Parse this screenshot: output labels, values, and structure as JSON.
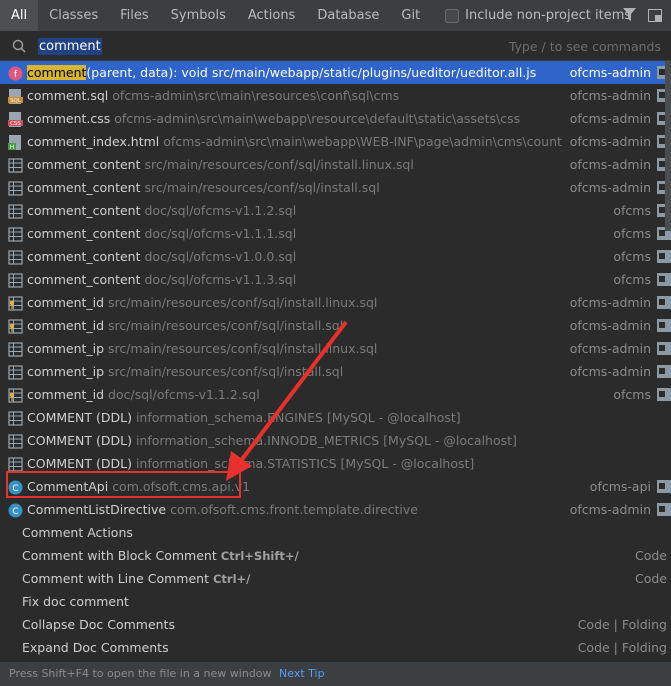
{
  "tabs": [
    {
      "label": "All",
      "active": true
    },
    {
      "label": "Classes",
      "active": false
    },
    {
      "label": "Files",
      "active": false
    },
    {
      "label": "Symbols",
      "active": false
    },
    {
      "label": "Actions",
      "active": false
    },
    {
      "label": "Database",
      "active": false
    },
    {
      "label": "Git",
      "active": false
    }
  ],
  "include_non_project": {
    "label": "Include non-project items",
    "checked": false
  },
  "toolbar": {
    "filter_icon": "filter-icon",
    "window_icon": "window-icon"
  },
  "search": {
    "value": "comment",
    "hint": "Type / to see commands"
  },
  "results": [
    {
      "icon": "function-icon",
      "name_highlight": "comment",
      "name_rest": "(parent, data): void src/main/webapp/static/plugins/ueditor/ueditor.all.js",
      "path": "",
      "module": "ofcms-admin",
      "selected": true
    },
    {
      "icon": "sql-file-icon",
      "name_highlight": "",
      "name_rest": "comment.sql",
      "path": "ofcms-admin\\src\\main\\resources\\conf\\sql\\cms",
      "module": "ofcms-admin",
      "selected": false
    },
    {
      "icon": "css-file-icon",
      "name_highlight": "",
      "name_rest": "comment.css",
      "path": "ofcms-admin\\src\\main\\webapp\\resource\\default\\static\\assets\\css",
      "module": "ofcms-admin",
      "selected": false
    },
    {
      "icon": "html-file-icon",
      "name_highlight": "",
      "name_rest": "comment_index.html",
      "path": "ofcms-admin\\src\\main\\webapp\\WEB-INF\\page\\admin\\cms\\count",
      "module": "ofcms-admin",
      "selected": false
    },
    {
      "icon": "table-icon",
      "name_highlight": "",
      "name_rest": "comment_content",
      "path": "src/main/resources/conf/sql/install.linux.sql",
      "module": "ofcms-admin",
      "selected": false
    },
    {
      "icon": "table-icon",
      "name_highlight": "",
      "name_rest": "comment_content",
      "path": "src/main/resources/conf/sql/install.sql",
      "module": "ofcms-admin",
      "selected": false
    },
    {
      "icon": "table-icon",
      "name_highlight": "",
      "name_rest": "comment_content",
      "path": "doc/sql/ofcms-v1.1.2.sql",
      "module": "ofcms",
      "selected": false
    },
    {
      "icon": "table-icon",
      "name_highlight": "",
      "name_rest": "comment_content",
      "path": "doc/sql/ofcms-v1.1.1.sql",
      "module": "ofcms",
      "selected": false
    },
    {
      "icon": "table-icon",
      "name_highlight": "",
      "name_rest": "comment_content",
      "path": "doc/sql/ofcms-v1.0.0.sql",
      "module": "ofcms",
      "selected": false
    },
    {
      "icon": "table-icon",
      "name_highlight": "",
      "name_rest": "comment_content",
      "path": "doc/sql/ofcms-v1.1.3.sql",
      "module": "ofcms",
      "selected": false
    },
    {
      "icon": "key-table-icon",
      "name_highlight": "",
      "name_rest": "comment_id",
      "path": "src/main/resources/conf/sql/install.linux.sql",
      "module": "ofcms-admin",
      "selected": false
    },
    {
      "icon": "key-table-icon",
      "name_highlight": "",
      "name_rest": "comment_id",
      "path": "src/main/resources/conf/sql/install.sql",
      "module": "ofcms-admin",
      "selected": false
    },
    {
      "icon": "table-icon",
      "name_highlight": "",
      "name_rest": "comment_ip",
      "path": "src/main/resources/conf/sql/install.linux.sql",
      "module": "ofcms-admin",
      "selected": false
    },
    {
      "icon": "table-icon",
      "name_highlight": "",
      "name_rest": "comment_ip",
      "path": "src/main/resources/conf/sql/install.sql",
      "module": "ofcms-admin",
      "selected": false
    },
    {
      "icon": "key-table-icon",
      "name_highlight": "",
      "name_rest": "comment_id",
      "path": "doc/sql/ofcms-v1.1.2.sql",
      "module": "ofcms",
      "selected": false
    },
    {
      "icon": "table-icon",
      "name_highlight": "",
      "name_rest": "COMMENT (DDL)",
      "path": "information_schema.ENGINES [MySQL - @localhost]",
      "module": "",
      "selected": false
    },
    {
      "icon": "table-icon",
      "name_highlight": "",
      "name_rest": "COMMENT (DDL)",
      "path": "information_schema.INNODB_METRICS [MySQL - @localhost]",
      "module": "",
      "selected": false
    },
    {
      "icon": "table-icon",
      "name_highlight": "",
      "name_rest": "COMMENT (DDL)",
      "path": "information_schema.STATISTICS [MySQL - @localhost]",
      "module": "",
      "selected": false
    },
    {
      "icon": "class-icon",
      "name_highlight": "",
      "name_rest": "CommentApi",
      "path": "com.ofsoft.cms.api.v1",
      "module": "ofcms-api",
      "selected": false
    },
    {
      "icon": "class-icon",
      "name_highlight": "",
      "name_rest": "CommentListDirective",
      "path": "com.ofsoft.cms.front.template.directive",
      "module": "ofcms-admin",
      "selected": false
    }
  ],
  "actions": [
    {
      "label": "Comment Actions",
      "shortcut": "",
      "group": ""
    },
    {
      "label": "Comment with Block Comment",
      "shortcut": "Ctrl+Shift+/",
      "group": "Code"
    },
    {
      "label": "Comment with Line Comment",
      "shortcut": "Ctrl+/",
      "group": "Code"
    },
    {
      "label": "Fix doc comment",
      "shortcut": "",
      "group": ""
    },
    {
      "label": "Collapse Doc Comments",
      "shortcut": "",
      "group": "Code | Folding"
    },
    {
      "label": "Expand Doc Comments",
      "shortcut": "",
      "group": "Code | Folding"
    }
  ],
  "footer": {
    "text": "Press Shift+F4 to open the file in a new window",
    "link": "Next Tip"
  },
  "colors": {
    "selection": "#2f65ca",
    "highlight": "#d9b630",
    "annotation_red": "#e8302d",
    "link": "#589df6"
  }
}
